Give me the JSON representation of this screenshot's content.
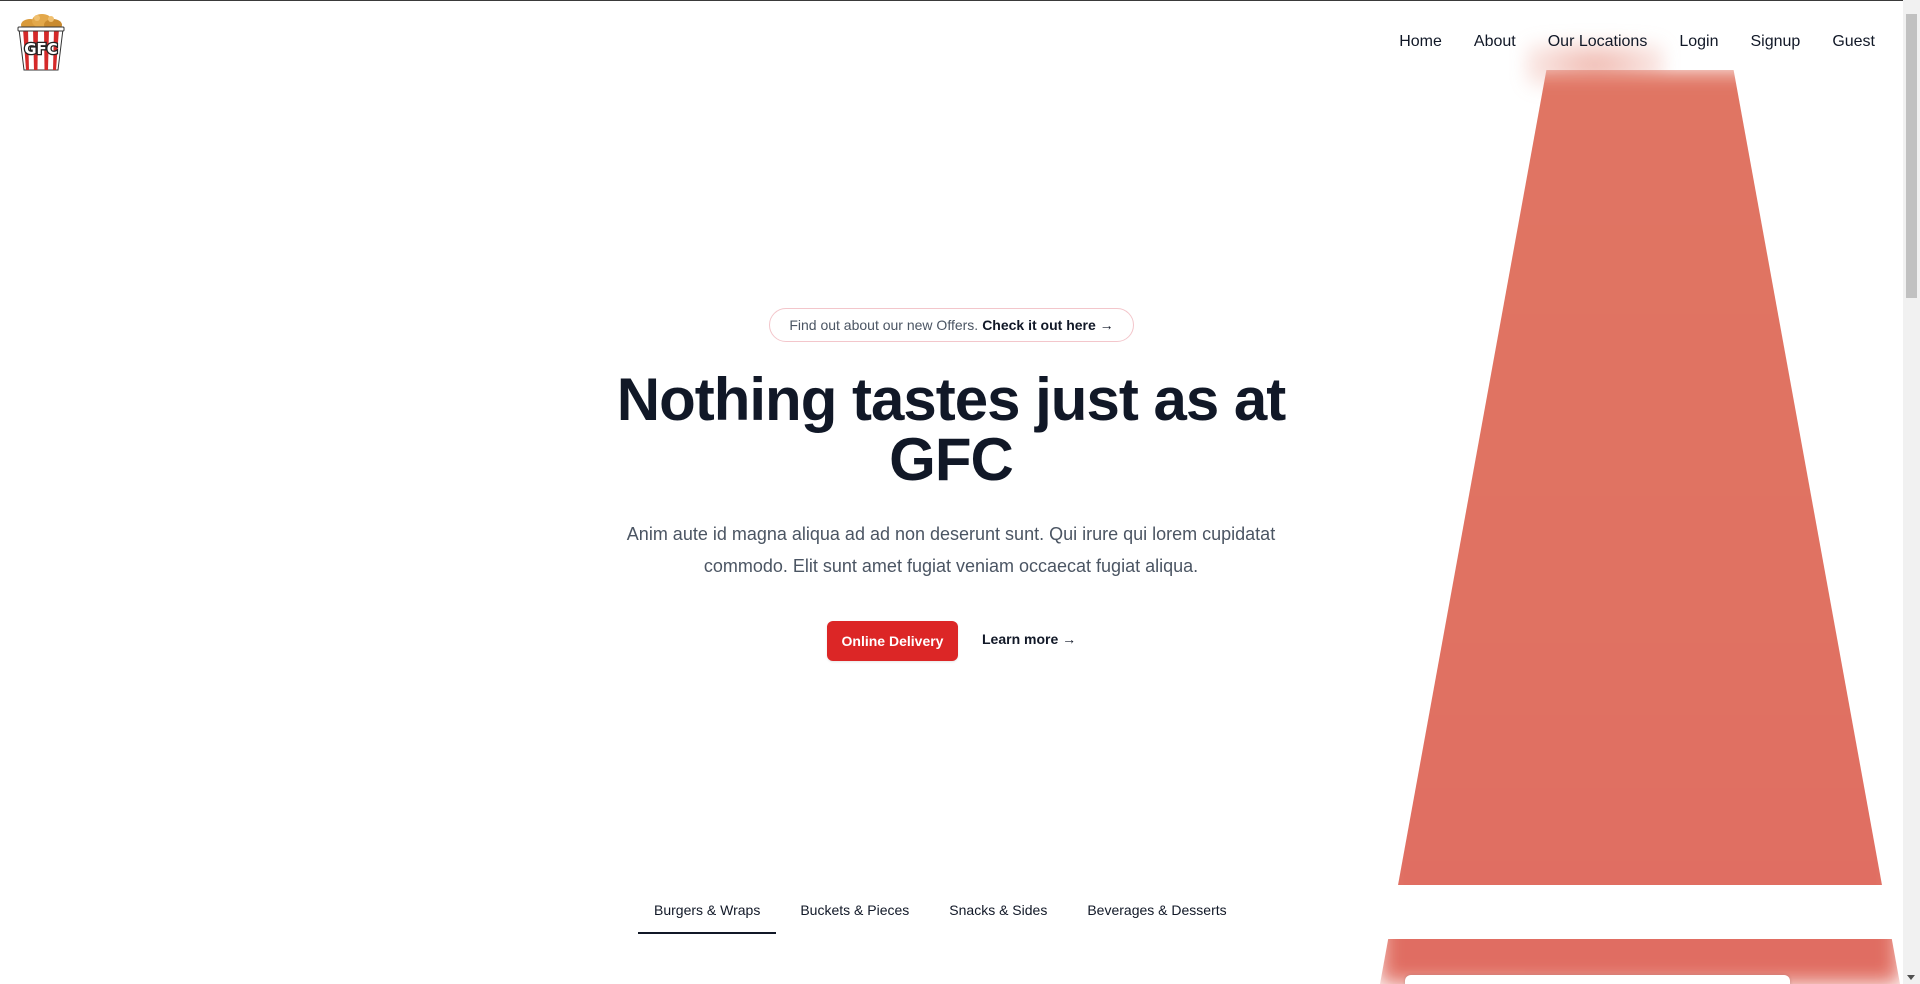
{
  "brand": {
    "logo_text": "GFC",
    "accent": "#dc2626",
    "beam_color": "#e0705f"
  },
  "nav": {
    "items": [
      "Home",
      "About",
      "Our Locations",
      "Login",
      "Signup",
      "Guest"
    ]
  },
  "hero": {
    "offer_text": "Find out about our new Offers.",
    "offer_link": "Check it out here →",
    "headline": "Nothing tastes just as at GFC",
    "subtext": "Anim aute id magna aliqua ad ad non deserunt sunt. Qui irure qui lorem cupidatat commodo. Elit sunt amet fugiat veniam occaecat fugiat aliqua.",
    "cta_label": "Online Delivery",
    "secondary_label": "Learn more →"
  },
  "menu_tabs": {
    "items": [
      "Burgers & Wraps",
      "Buckets & Pieces",
      "Snacks & Sides",
      "Beverages & Desserts"
    ],
    "active": "Burgers & Wraps"
  }
}
